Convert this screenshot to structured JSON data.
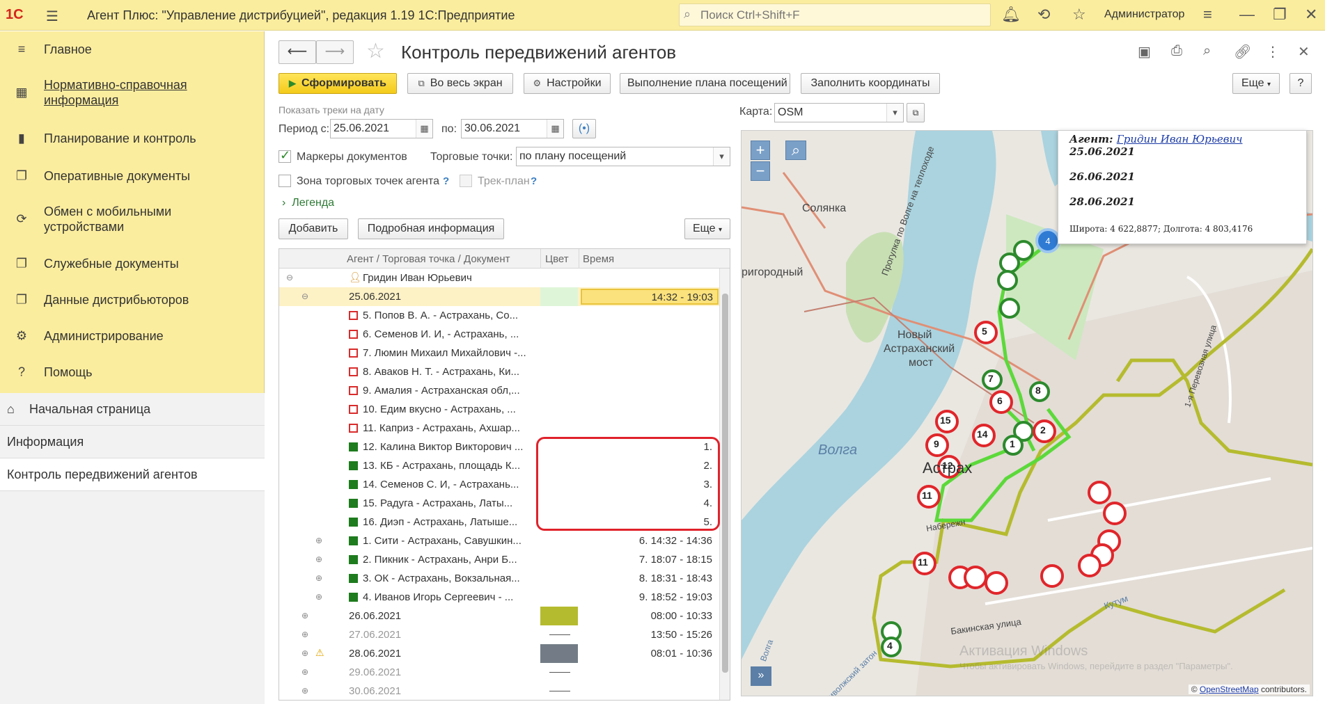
{
  "app": {
    "logo": "1С",
    "title": "Агент Плюс: \"Управление дистрибуцией\", редакция 1.19 1С:Предприятие",
    "search_placeholder": "Поиск Ctrl+Shift+F",
    "user": "Администратор"
  },
  "sidebar": {
    "items": [
      {
        "label": "Главное",
        "icon": "menu-icon"
      },
      {
        "label": "Нормативно-справочная информация",
        "icon": "catalog-icon"
      },
      {
        "label": "Планирование и контроль",
        "icon": "chart-icon"
      },
      {
        "label": "Оперативные документы",
        "icon": "documents-icon"
      },
      {
        "label": "Обмен с мобильными устройствами",
        "icon": "sync-icon"
      },
      {
        "label": "Служебные документы",
        "icon": "service-docs-icon"
      },
      {
        "label": "Данные дистрибьюторов",
        "icon": "distributor-data-icon"
      },
      {
        "label": "Администрирование",
        "icon": "gear-icon"
      },
      {
        "label": "Помощь",
        "icon": "question-icon"
      }
    ],
    "lower": [
      {
        "label": "Начальная страница"
      },
      {
        "label": "Информация"
      },
      {
        "label": "Контроль передвижений агентов"
      }
    ]
  },
  "form": {
    "title": "Контроль передвижений агентов",
    "toolbar": {
      "generate": "Сформировать",
      "fullscreen": "Во весь экран",
      "settings": "Настройки",
      "plan": "Выполнение плана посещений",
      "fill_coords": "Заполнить координаты",
      "more": "Еще",
      "help": "?"
    },
    "show_tracks_label": "Показать треки на дату",
    "period_from_label": "Период с:",
    "period_from": "25.06.2021",
    "period_to_label": "по:",
    "period_to": "30.06.2021",
    "doc_markers_label": "Маркеры документов",
    "trade_points_label": "Торговые точки:",
    "trade_points_value": "по плану посещений",
    "agent_zone_label": "Зона торговых точек агента",
    "track_plan_label": "Трек-план",
    "legend_label": "Легенда",
    "add_button": "Добавить",
    "details_button": "Подробная информация",
    "more2": "Еще",
    "map_label": "Карта:",
    "map_value": "OSM"
  },
  "table": {
    "headers": [
      "Агент / Торговая точка / Документ",
      "Цвет",
      "Время"
    ],
    "rows": [
      {
        "level": 0,
        "expand": "⊖",
        "marker": "agent",
        "text": "Гридин Иван Юрьевич",
        "time": ""
      },
      {
        "level": 1,
        "expand": "⊖",
        "marker": "",
        "text": "25.06.2021",
        "time": "14:32 - 19:03",
        "selected": true,
        "color": "#dff5d8"
      },
      {
        "level": 2,
        "expand": "",
        "marker": "red",
        "text": "5. Попов В. А.  -  Астрахань, Со...",
        "time": ""
      },
      {
        "level": 2,
        "expand": "",
        "marker": "red",
        "text": "6. Семенов И. И,  -  Астрахань, ...",
        "time": ""
      },
      {
        "level": 2,
        "expand": "",
        "marker": "red",
        "text": "7. Люмин Михаил Михайлович  -...",
        "time": ""
      },
      {
        "level": 2,
        "expand": "",
        "marker": "red",
        "text": "8. Аваков Н. Т.  -  Астрахань, Ки...",
        "time": ""
      },
      {
        "level": 2,
        "expand": "",
        "marker": "red",
        "text": "9. Амалия  -  Астраханская обл,...",
        "time": ""
      },
      {
        "level": 2,
        "expand": "",
        "marker": "red",
        "text": "10. Едим вкусно  -  Астрахань, ...",
        "time": ""
      },
      {
        "level": 2,
        "expand": "",
        "marker": "red",
        "text": "11. Каприз  -  Астрахань, Ахшар...",
        "time": ""
      },
      {
        "level": 2,
        "expand": "",
        "marker": "green",
        "text": "12. Калина Виктор Викторович  ...",
        "time": "1."
      },
      {
        "level": 2,
        "expand": "",
        "marker": "green",
        "text": "13. КБ  -  Астрахань, площадь К...",
        "time": "2."
      },
      {
        "level": 2,
        "expand": "",
        "marker": "green",
        "text": "14. Семенов С. И,  -  Астрахань...",
        "time": "3."
      },
      {
        "level": 2,
        "expand": "",
        "marker": "green",
        "text": "15. Радуга  -  Астрахань, Латы...",
        "time": "4."
      },
      {
        "level": 2,
        "expand": "",
        "marker": "green",
        "text": "16. Диэп  -  Астрахань, Латыше...",
        "time": "5."
      },
      {
        "level": 2,
        "expand": "⊕",
        "marker": "green",
        "text": "1. Сити  -  Астрахань, Савушкин...",
        "time": "6. 14:32 - 14:36"
      },
      {
        "level": 2,
        "expand": "⊕",
        "marker": "green",
        "text": "2. Пикник  -  Астрахань, Анри Б...",
        "time": "7. 18:07 - 18:15"
      },
      {
        "level": 2,
        "expand": "⊕",
        "marker": "green",
        "text": "3. ОК  -  Астрахань, Вокзальная...",
        "time": "8. 18:31 - 18:43"
      },
      {
        "level": 2,
        "expand": "⊕",
        "marker": "green",
        "text": "4. Иванов Игорь Сергеевич  -  ...",
        "time": "9. 18:52 - 19:03"
      },
      {
        "level": 1,
        "expand": "⊕",
        "marker": "",
        "text": "26.06.2021",
        "time": "08:00 - 10:33",
        "color": "#b5bb2e"
      },
      {
        "level": 1,
        "expand": "⊕",
        "marker": "",
        "text": "27.06.2021",
        "time": "13:50 - 15:26",
        "dim": true,
        "dash": true
      },
      {
        "level": 1,
        "expand": "⊕",
        "marker": "warn",
        "text": "28.06.2021",
        "time": "08:01 - 10:36",
        "color": "#737c86"
      },
      {
        "level": 1,
        "expand": "⊕",
        "marker": "",
        "text": "29.06.2021",
        "time": "",
        "dim": true,
        "dash": true
      },
      {
        "level": 1,
        "expand": "⊕",
        "marker": "",
        "text": "30.06.2021",
        "time": "",
        "dim": true,
        "dash": true
      }
    ]
  },
  "map": {
    "popup": {
      "agent_prefix": "Агент:",
      "agent_name": "Гридин Иван Юрьевич",
      "dates": [
        "25.06.2021",
        "26.06.2021",
        "28.06.2021"
      ],
      "coords": "Широта: 4 622,8877; Долгота: 4 803,4176"
    },
    "labels": [
      {
        "text": "Солянка"
      },
      {
        "text": "ригородный"
      },
      {
        "text": "Новый"
      },
      {
        "text": "Астраханский"
      },
      {
        "text": "мост"
      },
      {
        "text": "Волга"
      },
      {
        "text": "Астрах"
      },
      {
        "text": "Бакинская улица"
      },
      {
        "text": "Кутум"
      },
      {
        "text": "Прогулка по Волге на теплоходе"
      },
      {
        "text": "1-я Перевозная улица"
      },
      {
        "text": "Набережн"
      },
      {
        "text": "Волга"
      },
      {
        "text": "Приволжский затон"
      }
    ],
    "attribution_prefix": "© ",
    "attribution_link": "OpenStreetMap",
    "attribution_suffix": " contributors.",
    "watermark": "Активация Windows",
    "watermark2": "Чтобы активировать Windows, перейдите в раздел \"Параметры\"."
  }
}
